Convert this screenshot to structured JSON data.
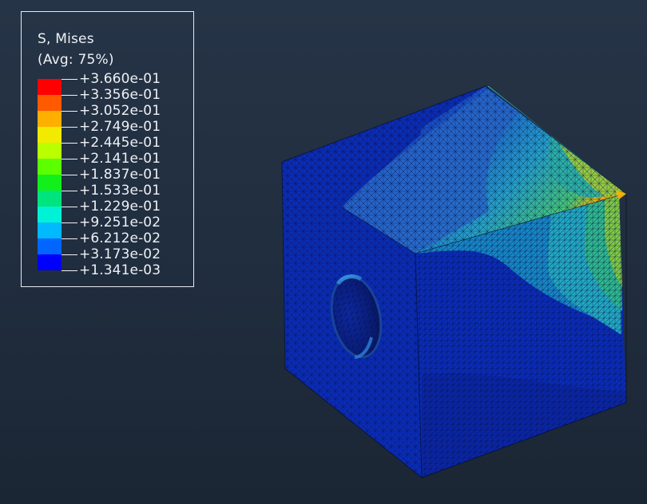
{
  "legend": {
    "title_line1": "S, Mises",
    "title_line2": "(Avg: 75%)",
    "labels": [
      "+3.660e-01",
      "+3.356e-01",
      "+3.052e-01",
      "+2.749e-01",
      "+2.445e-01",
      "+2.141e-01",
      "+1.837e-01",
      "+1.533e-01",
      "+1.229e-01",
      "+9.251e-02",
      "+6.212e-02",
      "+3.173e-02",
      "+1.341e-03"
    ],
    "colors": [
      "#ff0000",
      "#ff5a00",
      "#ffaf00",
      "#f2ea00",
      "#b9ff00",
      "#5cff00",
      "#12ef1a",
      "#00e47e",
      "#00f2d6",
      "#00b9ff",
      "#0066ff",
      "#0000ff"
    ]
  },
  "model": {
    "mesh_color": "#07113e",
    "face_colors": {
      "dark_blue": "#0a2cb8",
      "top_light_blue": "#2a7fc9",
      "cyan": "#1fb8b4",
      "green": "#49c46a",
      "yellow_green": "#b6d037",
      "orange_edge": "#ffb000"
    }
  }
}
